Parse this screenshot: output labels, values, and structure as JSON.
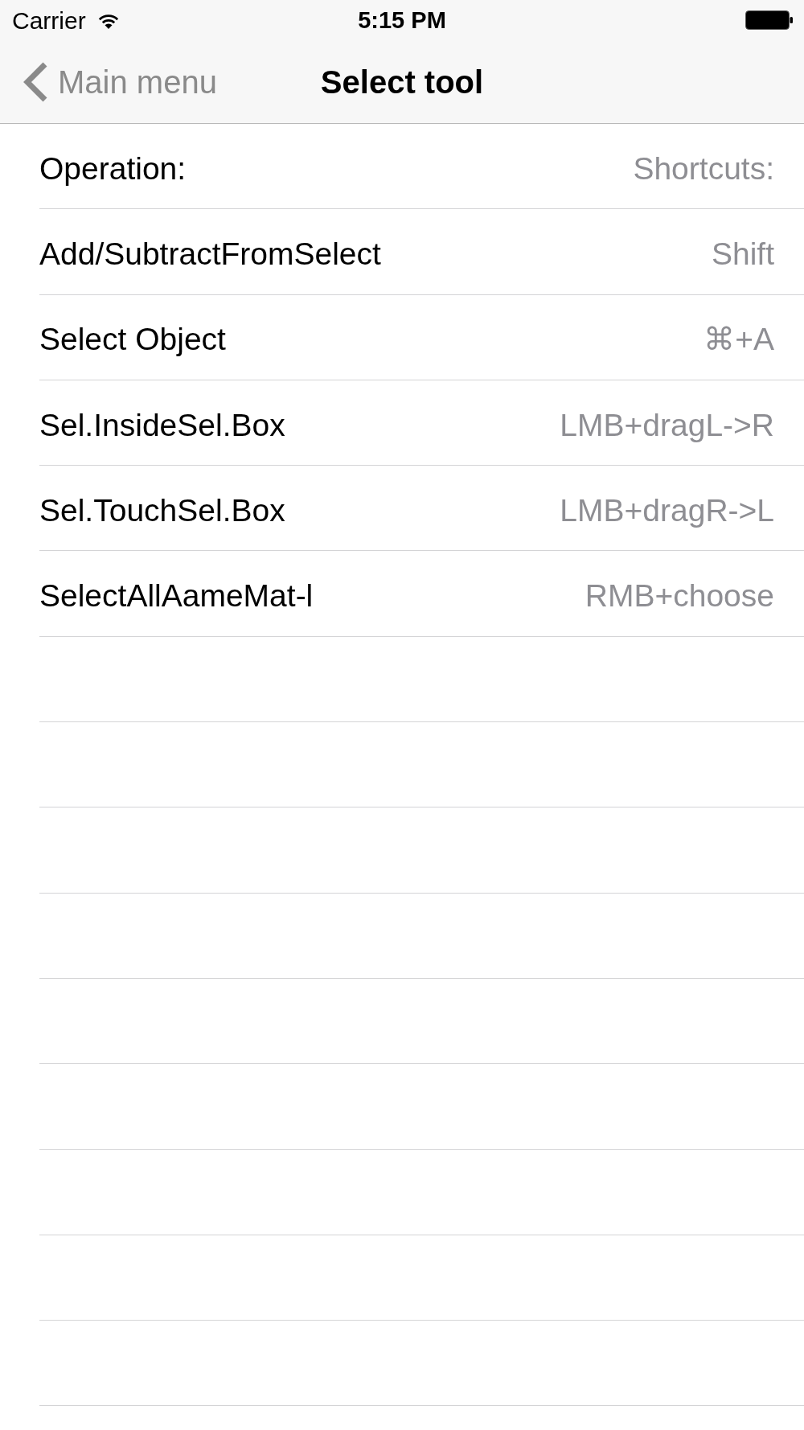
{
  "status_bar": {
    "carrier": "Carrier",
    "time": "5:15 PM"
  },
  "nav_bar": {
    "back_label": "Main menu",
    "title": "Select tool"
  },
  "table": {
    "columns": [
      "Operation:",
      "Shortcuts:"
    ],
    "rows": [
      {
        "operation": "Add/SubtractFromSelect",
        "shortcut": "Shift"
      },
      {
        "operation": "Select Object",
        "shortcut": "⌘+A"
      },
      {
        "operation": "Sel.InsideSel.Box",
        "shortcut": "LMB+dragL->R"
      },
      {
        "operation": "Sel.TouchSel.Box",
        "shortcut": "LMB+dragR->L"
      },
      {
        "operation": "SelectAllAameMat-l",
        "shortcut": "RMB+choose"
      }
    ]
  }
}
